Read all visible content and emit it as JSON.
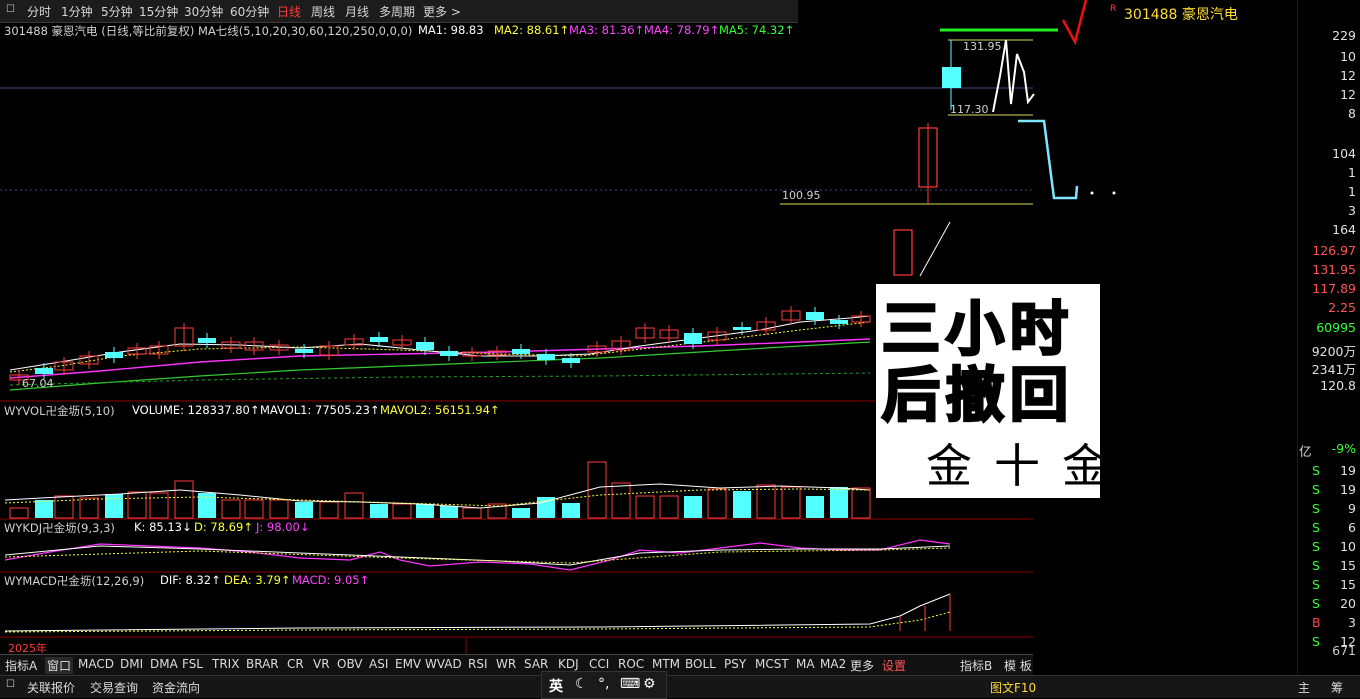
{
  "toolbar": {
    "periods": [
      "分时",
      "1分钟",
      "5分钟",
      "15分钟",
      "30分钟",
      "60分钟",
      "日线",
      "周线",
      "月线",
      "多周期",
      "更多 >"
    ],
    "active": "日线"
  },
  "main_info": {
    "title": "301488 豪恩汽电 (日线,等比前复权)",
    "ma_label": "MA七线(5,10,20,30,60,120,250,0,0,0)",
    "ma1": "MA1: 98.83",
    "ma2": "MA2: 88.61↑",
    "ma3": "MA3: 81.36↑",
    "ma4": "MA4: 78.79↑",
    "ma5": "MA5: 74.32↑"
  },
  "price_labels": {
    "high": "131.95",
    "l117": "117.30",
    "l100": "100.95",
    "low": "67.04"
  },
  "volume_info": {
    "name": "WYVOL卍金坜(5,10)",
    "volume": "VOLUME: 128337.80↑",
    "mavol1": "MAVOL1: 77505.23↑",
    "mavol2": "MAVOL2: 56151.94↑"
  },
  "kdj_info": {
    "name": "WYKDJ卍金坜(9,3,3)",
    "k": "K: 85.13↓",
    "d": "D: 78.69↑",
    "j": "J: 98.00↓"
  },
  "macd_info": {
    "name": "WYMACD卍金坜(12,26,9)",
    "dif": "DIF: 8.32↑",
    "dea": "DEA: 3.79↑",
    "macd": "MACD: 9.05↑"
  },
  "year_label": "2025年",
  "overlay": {
    "line1": "三小时",
    "line2": "后撤回",
    "line3": "金十金"
  },
  "right_panel": {
    "stock": "301488 豪恩汽电",
    "values": [
      "229",
      "10",
      "12",
      "12",
      "8",
      "104",
      "1",
      "1",
      "3",
      "164",
      "126.97",
      "131.95",
      "117.89",
      "2.25",
      "60995",
      "9200万",
      "2341万",
      "120.8"
    ],
    "yi_label": "亿",
    "yi_pct": "-9%",
    "trades": [
      {
        "side": "S",
        "n": "19"
      },
      {
        "side": "S",
        "n": "19"
      },
      {
        "side": "S",
        "n": "9"
      },
      {
        "side": "S",
        "n": "6"
      },
      {
        "side": "S",
        "n": "10"
      },
      {
        "side": "S",
        "n": "15"
      },
      {
        "side": "S",
        "n": "15"
      },
      {
        "side": "S",
        "n": "20"
      },
      {
        "side": "B",
        "n": "3"
      },
      {
        "side": "S",
        "n": "12"
      }
    ],
    "last": "671"
  },
  "indicator_tabs": [
    "指标A",
    "窗口",
    "MACD",
    "DMI",
    "DMA",
    "FSL",
    "TRIX",
    "BRAR",
    "CR",
    "VR",
    "OBV",
    "ASI",
    "EMV",
    "WVAD",
    "RSI",
    "WR",
    "SAR",
    "KDJ",
    "CCI",
    "ROC",
    "MTM",
    "BOLL",
    "PSY",
    "MCST",
    "MA",
    "MA2",
    "更多",
    "设置",
    "指标B",
    "模 板"
  ],
  "status": {
    "left_tabs": [
      "关联报价",
      "交易查询",
      "资金流向"
    ],
    "ime": "英",
    "right_label": "图文F10",
    "corner1": "主",
    "corner2": "筹"
  },
  "colors": {
    "up": "#ff3b3b",
    "down": "#54ffff",
    "ma1": "#ffffff",
    "ma2": "#ffff00",
    "ma3": "#ff33ff",
    "ma4": "#33ff33",
    "ma5": "#00ff00"
  }
}
